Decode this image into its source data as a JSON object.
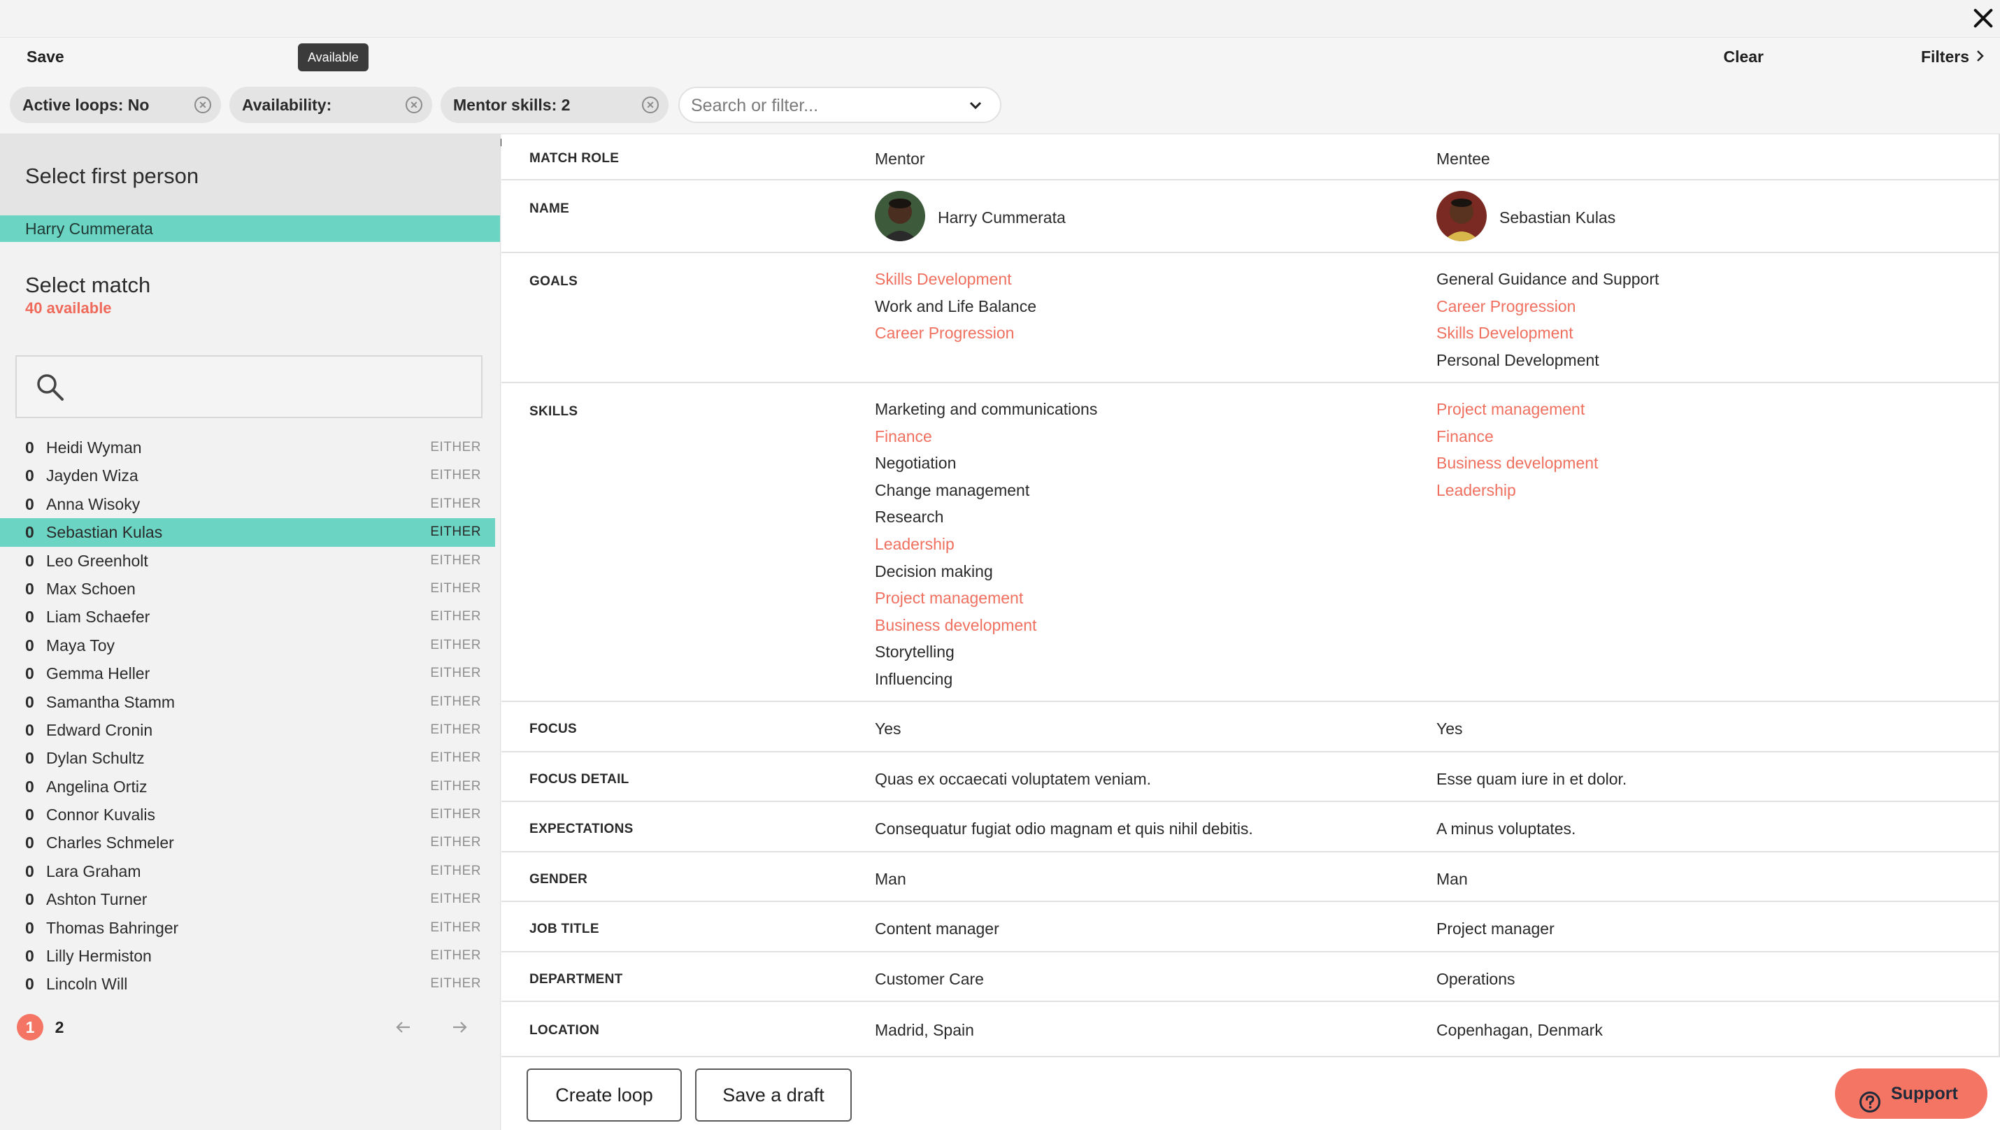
{
  "toolbar": {
    "save_label": "Save",
    "tooltip": "Available",
    "clear_label": "Clear",
    "filters_label": "Filters"
  },
  "filters": {
    "chips": [
      "Active loops: No loops",
      "Availability: Available",
      "Mentor skills: 2 selected"
    ],
    "search_placeholder": "Search or filter..."
  },
  "left": {
    "first_heading": "Select first person",
    "first_person": "Harry Cummerata",
    "match_heading": "Select match",
    "available": "40 available",
    "people": [
      {
        "count": "0",
        "name": "Heidi Wyman",
        "role": "EITHER"
      },
      {
        "count": "0",
        "name": "Jayden Wiza",
        "role": "EITHER"
      },
      {
        "count": "0",
        "name": "Anna Wisoky",
        "role": "EITHER"
      },
      {
        "count": "0",
        "name": "Sebastian Kulas",
        "role": "EITHER",
        "selected": true
      },
      {
        "count": "0",
        "name": "Leo Greenholt",
        "role": "EITHER"
      },
      {
        "count": "0",
        "name": "Max Schoen",
        "role": "EITHER"
      },
      {
        "count": "0",
        "name": "Liam Schaefer",
        "role": "EITHER"
      },
      {
        "count": "0",
        "name": "Maya Toy",
        "role": "EITHER"
      },
      {
        "count": "0",
        "name": "Gemma Heller",
        "role": "EITHER"
      },
      {
        "count": "0",
        "name": "Samantha Stamm",
        "role": "EITHER"
      },
      {
        "count": "0",
        "name": "Edward Cronin",
        "role": "EITHER"
      },
      {
        "count": "0",
        "name": "Dylan Schultz",
        "role": "EITHER"
      },
      {
        "count": "0",
        "name": "Angelina Ortiz",
        "role": "EITHER"
      },
      {
        "count": "0",
        "name": "Connor Kuvalis",
        "role": "EITHER"
      },
      {
        "count": "0",
        "name": "Charles Schmeler",
        "role": "EITHER"
      },
      {
        "count": "0",
        "name": "Lara Graham",
        "role": "EITHER"
      },
      {
        "count": "0",
        "name": "Ashton Turner",
        "role": "EITHER"
      },
      {
        "count": "0",
        "name": "Thomas Bahringer",
        "role": "EITHER"
      },
      {
        "count": "0",
        "name": "Lilly Hermiston",
        "role": "EITHER"
      },
      {
        "count": "0",
        "name": "Lincoln Will",
        "role": "EITHER"
      }
    ],
    "pages": [
      "1",
      "2"
    ]
  },
  "table": {
    "match_role": {
      "label": "MATCH ROLE",
      "mentor": "Mentor",
      "mentee": "Mentee"
    },
    "name": {
      "label": "NAME",
      "mentor": "Harry Cummerata",
      "mentee": "Sebastian Kulas"
    },
    "goals": {
      "label": "GOALS",
      "mentor": [
        {
          "text": "Skills Development",
          "highlight": true
        },
        {
          "text": "Work and Life Balance",
          "highlight": false
        },
        {
          "text": "Career Progression",
          "highlight": true
        }
      ],
      "mentee": [
        {
          "text": "General Guidance and Support",
          "highlight": false
        },
        {
          "text": "Career Progression",
          "highlight": true
        },
        {
          "text": "Skills Development",
          "highlight": true
        },
        {
          "text": "Personal Development",
          "highlight": false
        }
      ]
    },
    "skills": {
      "label": "SKILLS",
      "mentor": [
        {
          "text": "Marketing and communications",
          "highlight": false
        },
        {
          "text": "Finance",
          "highlight": true
        },
        {
          "text": "Negotiation",
          "highlight": false
        },
        {
          "text": "Change management",
          "highlight": false
        },
        {
          "text": "Research",
          "highlight": false
        },
        {
          "text": "Leadership",
          "highlight": true
        },
        {
          "text": "Decision making",
          "highlight": false
        },
        {
          "text": "Project management",
          "highlight": true
        },
        {
          "text": "Business development",
          "highlight": true
        },
        {
          "text": "Storytelling",
          "highlight": false
        },
        {
          "text": "Influencing",
          "highlight": false
        }
      ],
      "mentee": [
        {
          "text": "Project management",
          "highlight": true
        },
        {
          "text": "Finance",
          "highlight": true
        },
        {
          "text": "Business development",
          "highlight": true
        },
        {
          "text": "Leadership",
          "highlight": true
        }
      ]
    },
    "focus": {
      "label": "FOCUS",
      "mentor": "Yes",
      "mentee": "Yes"
    },
    "focus_detail": {
      "label": "FOCUS DETAIL",
      "mentor": "Quas ex occaecati voluptatem veniam.",
      "mentee": "Esse quam iure in et dolor."
    },
    "expectations": {
      "label": "EXPECTATIONS",
      "mentor": "Consequatur fugiat odio magnam et quis nihil debitis.",
      "mentee": "A minus voluptates."
    },
    "gender": {
      "label": "GENDER",
      "mentor": "Man",
      "mentee": "Man"
    },
    "job_title": {
      "label": "JOB TITLE",
      "mentor": "Content manager",
      "mentee": "Project manager"
    },
    "department": {
      "label": "DEPARTMENT",
      "mentor": "Customer Care",
      "mentee": "Operations"
    },
    "location": {
      "label": "LOCATION",
      "mentor": "Madrid, Spain",
      "mentee": "Copenhagan, Denmark"
    }
  },
  "footer": {
    "create_label": "Create loop",
    "draft_label": "Save a draft",
    "support_label": "Support"
  },
  "colors": {
    "accent": "#f0705f",
    "selection": "#6cd4c2",
    "support_bg": "#f47563"
  }
}
